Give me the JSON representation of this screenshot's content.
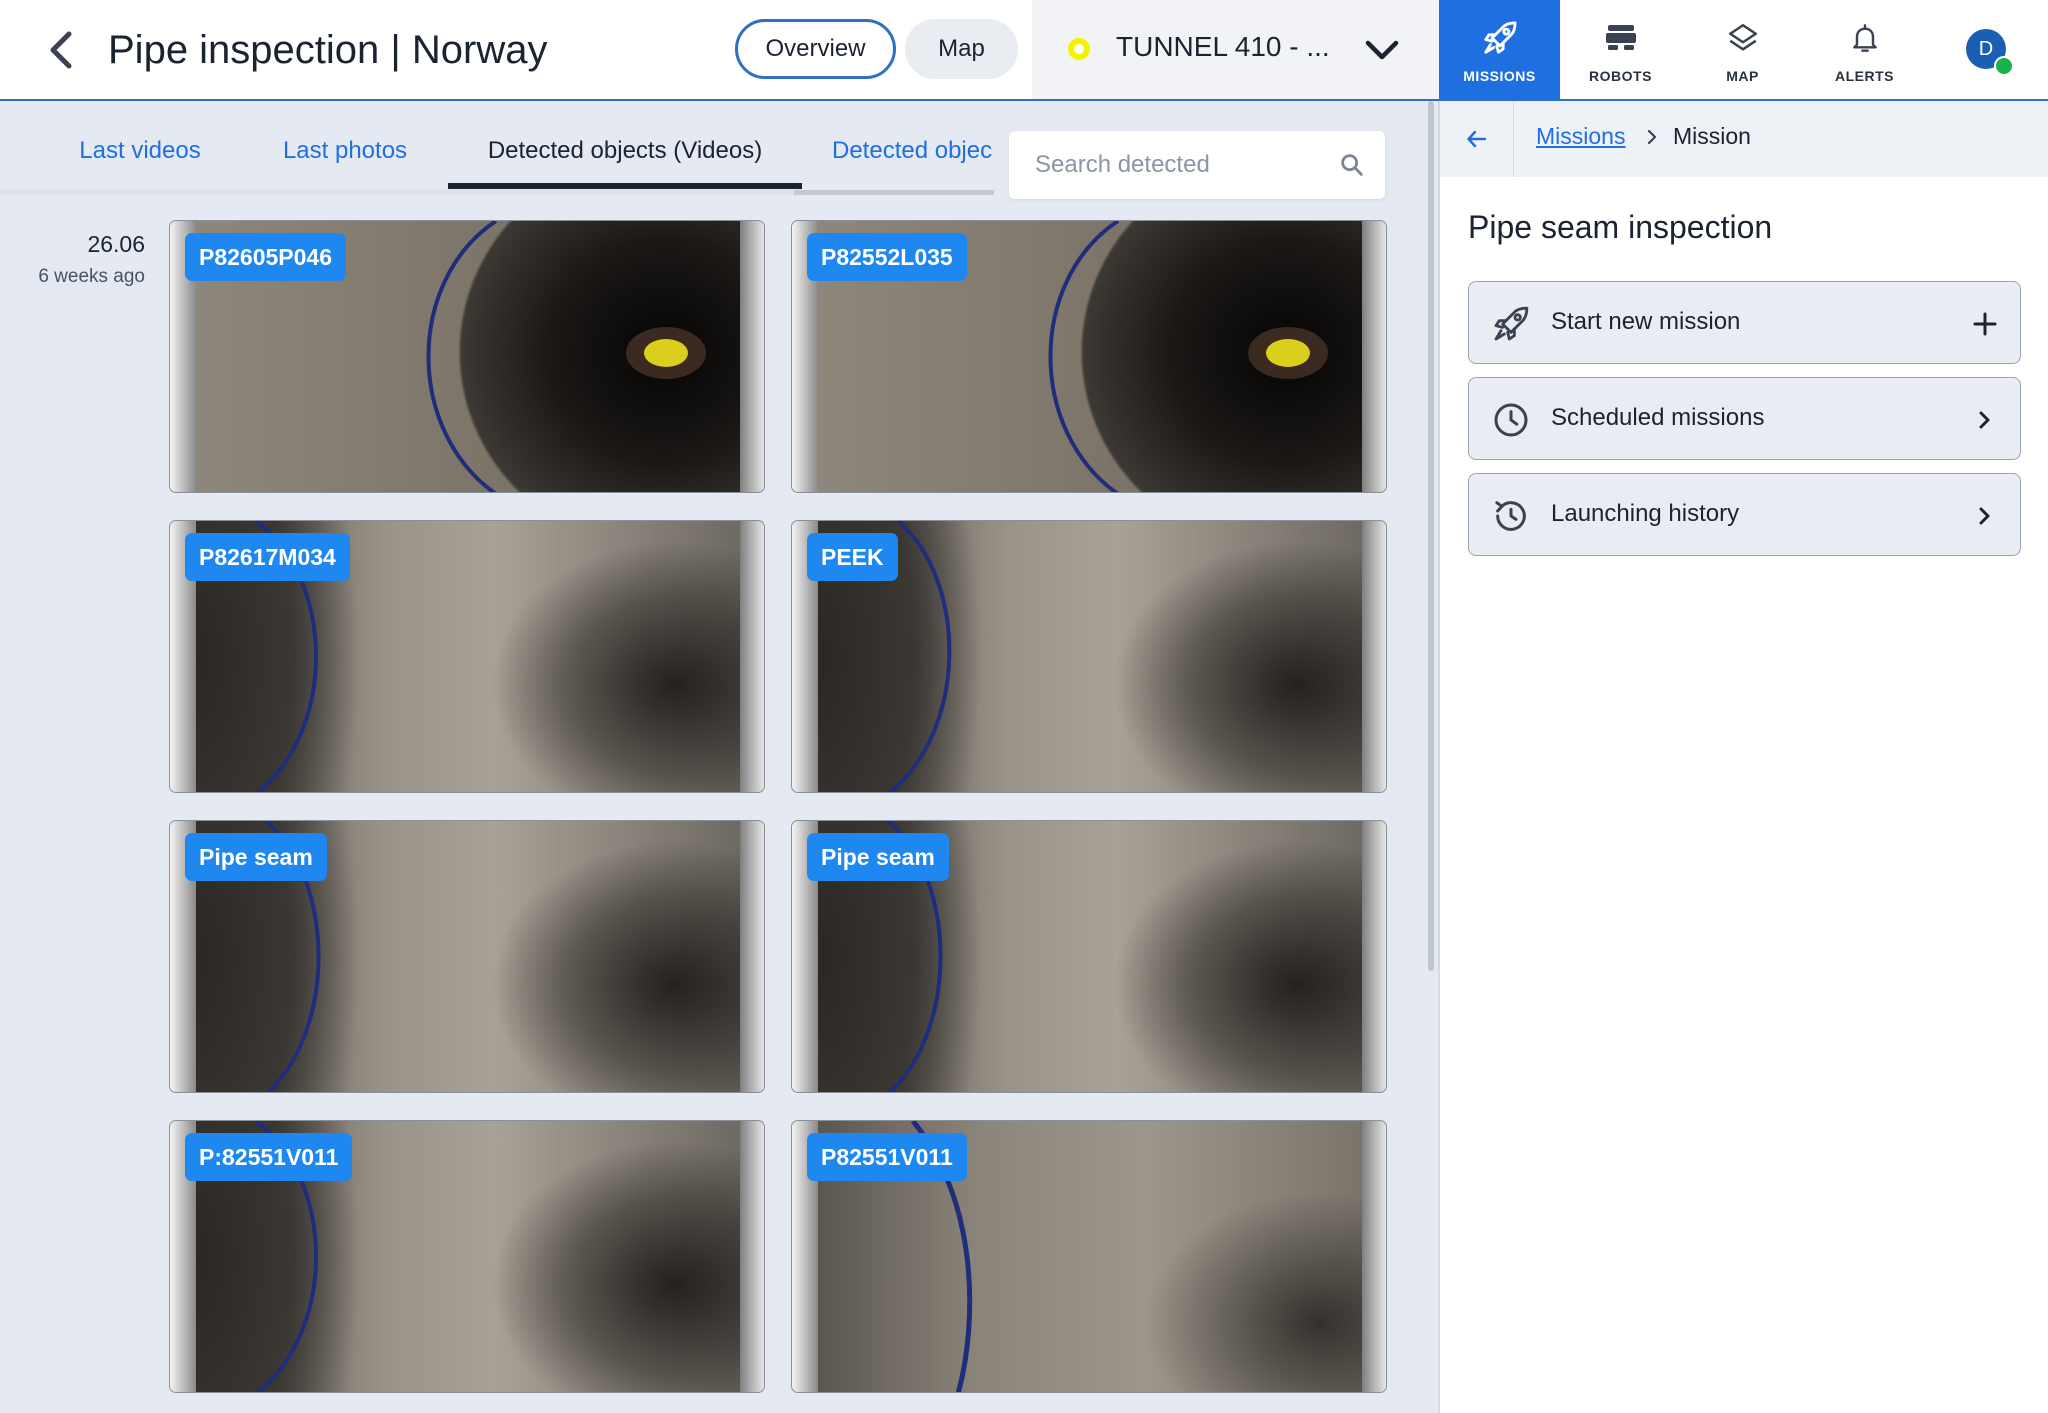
{
  "header": {
    "title": "Pipe inspection | Norway",
    "overview_label": "Overview",
    "map_label": "Map",
    "tunnel_label": "TUNNEL 410 - ...",
    "tunnel_status_color": "#f3f300"
  },
  "nav": {
    "missions": "MISSIONS",
    "robots": "ROBOTS",
    "map": "MAP",
    "alerts": "ALERTS",
    "avatar_initial": "D",
    "active": "missions"
  },
  "tabs": [
    "Last videos",
    "Last photos",
    "Detected objects (Videos)",
    "Detected objec"
  ],
  "search": {
    "placeholder": "Search detected"
  },
  "group": {
    "date": "26.06",
    "relative": "6 weeks ago"
  },
  "thumbnails": [
    {
      "tag": "P82605P046",
      "scene": "pipe-end-robot"
    },
    {
      "tag": "P82552L035",
      "scene": "pipe-end-robot"
    },
    {
      "tag": "P82617M034",
      "scene": "pipe-seam-marking"
    },
    {
      "tag": "PEEK",
      "scene": "pipe-seam-marking"
    },
    {
      "tag": "Pipe seam",
      "scene": "pipe-seam-marking"
    },
    {
      "tag": "Pipe seam",
      "scene": "pipe-seam-marking"
    },
    {
      "tag": "P:82551V011",
      "scene": "pipe-seam-marking"
    },
    {
      "tag": "P82551V011",
      "scene": "pipe-seam-marking"
    }
  ],
  "sidebar": {
    "breadcrumb_link": "Missions",
    "breadcrumb_current": "Mission",
    "title": "Pipe seam inspection",
    "actions": [
      {
        "label": "Start new mission",
        "icon": "rocket-icon",
        "trail": "plus-icon"
      },
      {
        "label": "Scheduled missions",
        "icon": "clock-icon",
        "trail": "chevron-right-icon"
      },
      {
        "label": "Launching history",
        "icon": "history-icon",
        "trail": "chevron-right-icon"
      }
    ]
  },
  "colors": {
    "accent": "#1e6fe0",
    "tag_bg": "#1e88f0",
    "panel_bg": "#e5e9f1"
  }
}
